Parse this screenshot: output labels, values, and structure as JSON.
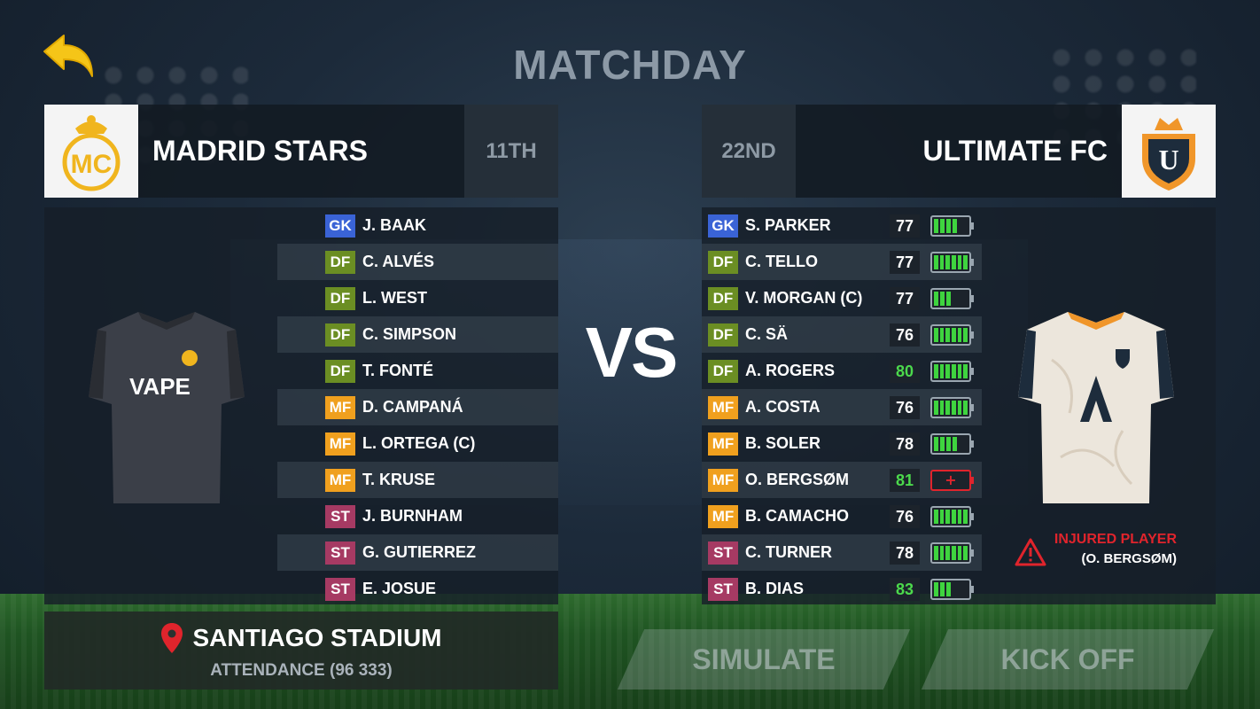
{
  "title": "MATCHDAY",
  "colors": {
    "gk": "#3a63d6",
    "df": "#6b8e23",
    "mf": "#f0a01e",
    "st": "#a63a63",
    "injury": "#e0242c",
    "high_rating": "#4cd94c"
  },
  "home": {
    "name": "MADRID STARS",
    "rank": "11TH",
    "jersey_sponsor": "VAPE",
    "players": [
      {
        "pos": "GK",
        "name": "J. BAAK"
      },
      {
        "pos": "DF",
        "name": "C. ALVÉS"
      },
      {
        "pos": "DF",
        "name": "L. WEST"
      },
      {
        "pos": "DF",
        "name": "C. SIMPSON"
      },
      {
        "pos": "DF",
        "name": "T. FONTÉ"
      },
      {
        "pos": "MF",
        "name": "D. CAMPANÁ"
      },
      {
        "pos": "MF",
        "name": "L. ORTEGA (C)"
      },
      {
        "pos": "MF",
        "name": "T. KRUSE"
      },
      {
        "pos": "ST",
        "name": "J. BURNHAM"
      },
      {
        "pos": "ST",
        "name": "G. GUTIERREZ"
      },
      {
        "pos": "ST",
        "name": "E. JOSUE"
      }
    ]
  },
  "vs": "VS",
  "away": {
    "name": "ULTIMATE FC",
    "rank": "22ND",
    "players": [
      {
        "pos": "GK",
        "name": "S. PARKER",
        "rating": "77",
        "stamina_cells": 4,
        "highlight": false,
        "injured": false
      },
      {
        "pos": "DF",
        "name": "C. TELLO",
        "rating": "77",
        "stamina_cells": 6,
        "highlight": false,
        "injured": false
      },
      {
        "pos": "DF",
        "name": "V. MORGAN (C)",
        "rating": "77",
        "stamina_cells": 3,
        "highlight": false,
        "injured": false
      },
      {
        "pos": "DF",
        "name": "C. SÄ",
        "rating": "76",
        "stamina_cells": 6,
        "highlight": false,
        "injured": false
      },
      {
        "pos": "DF",
        "name": "A. ROGERS",
        "rating": "80",
        "stamina_cells": 6,
        "highlight": true,
        "injured": false
      },
      {
        "pos": "MF",
        "name": "A. COSTA",
        "rating": "76",
        "stamina_cells": 6,
        "highlight": false,
        "injured": false
      },
      {
        "pos": "MF",
        "name": "B. SOLER",
        "rating": "78",
        "stamina_cells": 4,
        "highlight": false,
        "injured": false
      },
      {
        "pos": "MF",
        "name": "O. BERGSØM",
        "rating": "81",
        "stamina_cells": 0,
        "highlight": true,
        "injured": true,
        "injury_symbol": "+"
      },
      {
        "pos": "MF",
        "name": "B. CAMACHO",
        "rating": "76",
        "stamina_cells": 6,
        "highlight": false,
        "injured": false
      },
      {
        "pos": "ST",
        "name": "C. TURNER",
        "rating": "78",
        "stamina_cells": 6,
        "highlight": false,
        "injured": false
      },
      {
        "pos": "ST",
        "name": "B. DIAS",
        "rating": "83",
        "stamina_cells": 3,
        "highlight": true,
        "injured": false
      }
    ]
  },
  "injury_notice": {
    "label": "INJURED PLAYER",
    "player": "(O. BERGSØM)"
  },
  "stadium": {
    "name": "SANTIAGO STADIUM",
    "attendance": "ATTENDANCE (96 333)"
  },
  "buttons": {
    "simulate": "SIMULATE",
    "kick_off": "KICK OFF"
  }
}
